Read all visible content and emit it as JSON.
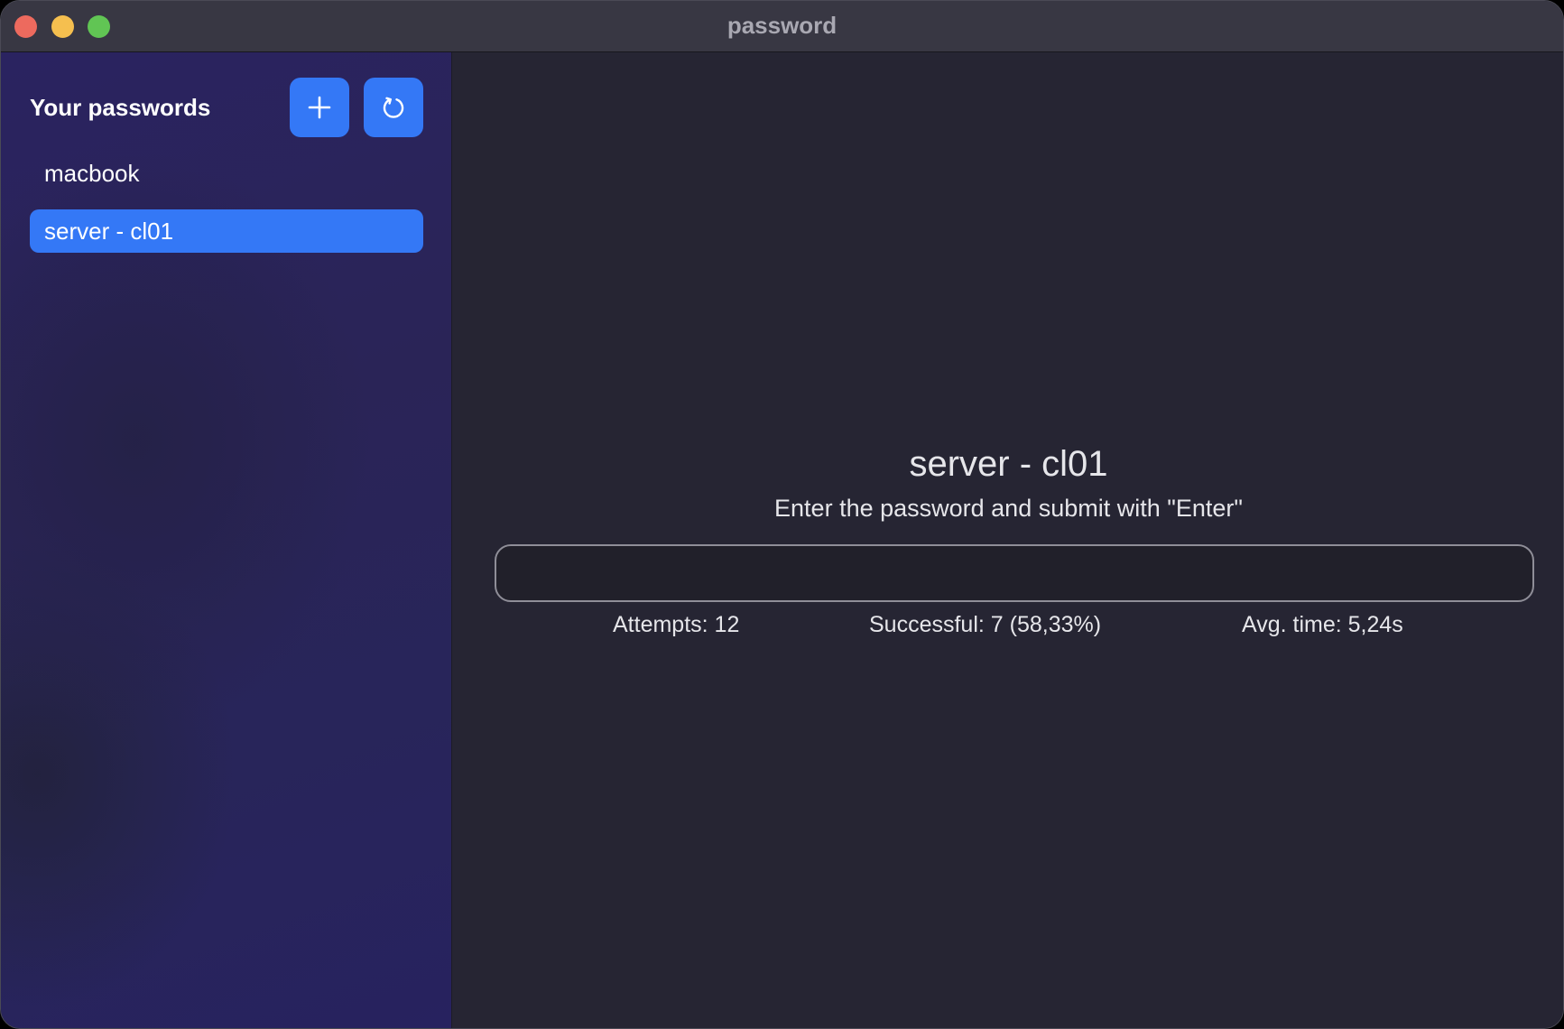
{
  "window": {
    "title": "password"
  },
  "sidebar": {
    "title": "Your passwords",
    "add_icon": "plus-icon",
    "refresh_icon": "refresh-icon",
    "items": [
      {
        "label": "macbook",
        "selected": false
      },
      {
        "label": "server - cl01",
        "selected": true
      }
    ]
  },
  "main": {
    "entry_title": "server - cl01",
    "subtitle": "Enter the password and submit with \"Enter\"",
    "input": {
      "value": "",
      "placeholder": ""
    },
    "stats": {
      "attempts": "Attempts: 12",
      "successful": "Successful: 7 (58,33%)",
      "avg_time": "Avg. time: 5,24s"
    }
  },
  "colors": {
    "accent": "#3478f6",
    "sidebar_bg": "#2a2458",
    "main_bg": "#262533",
    "titlebar_bg": "#383743"
  }
}
